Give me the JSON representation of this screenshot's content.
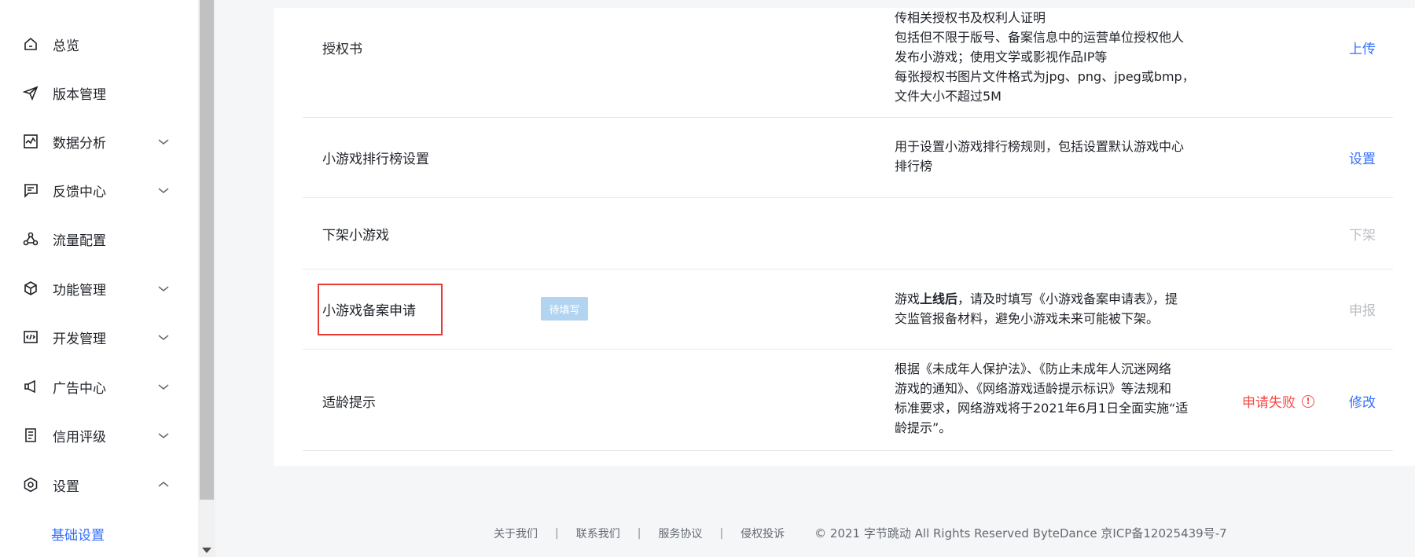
{
  "sidebar": {
    "items": [
      {
        "label": "总览"
      },
      {
        "label": "版本管理"
      },
      {
        "label": "数据分析"
      },
      {
        "label": "反馈中心"
      },
      {
        "label": "流量配置"
      },
      {
        "label": "功能管理"
      },
      {
        "label": "开发管理"
      },
      {
        "label": "广告中心"
      },
      {
        "label": "信用评级"
      },
      {
        "label": "设置"
      }
    ],
    "sub_item": "基础设置"
  },
  "rows": [
    {
      "title": "授权书",
      "desc_lines": [
        "传相关授权书及权利人证明",
        "包括但不限于版号、备案信息中的运营单位授权他人",
        "发布小游戏；使用文学或影视作品IP等",
        "每张授权书图片文件格式为jpg、png、jpeg或bmp，",
        "文件大小不超过5M"
      ],
      "action": "上传"
    },
    {
      "title": "小游戏排行榜设置",
      "desc_lines": [
        "用于设置小游戏排行榜规则，包括设置默认游戏中心",
        "排行榜"
      ],
      "action": "设置"
    },
    {
      "title": "下架小游戏",
      "action": "下架"
    },
    {
      "title": "小游戏备案申请",
      "badge": "待填写",
      "desc_pre": "游戏",
      "desc_bold": "上线后",
      "desc_post": "，请及时填写《小游戏备案申请表》，提",
      "desc_line2": "交监管报备材料，避免小游戏未来可能被下架。",
      "action": "申报"
    },
    {
      "title": "适龄提示",
      "desc_lines": [
        "根据《未成年人保护法》、《防止未成年人沉迷网络",
        "游戏的通知》、《网络游戏适龄提示标识》等法规和",
        "标准要求，网络游戏将于2021年6月1日全面实施“适",
        "龄提示”。"
      ],
      "status": "申请失败",
      "action": "修改"
    }
  ],
  "footer": {
    "links": [
      "关于我们",
      "联系我们",
      "服务协议",
      "侵权投诉"
    ],
    "separator": "|",
    "copyright": "© 2021 字节跳动 All Rights Reserved ByteDance 京ICP备12025439号-7"
  },
  "colors": {
    "accent": "#3370ff",
    "danger": "#f54a45",
    "highlight_border": "#e53935",
    "badge_bg": "#b3d4f0"
  },
  "icons": [
    "home-icon",
    "send-icon",
    "chart-icon",
    "message-icon",
    "flow-icon",
    "cube-icon",
    "code-icon",
    "megaphone-icon",
    "document-icon",
    "settings-icon",
    "chevron-down-icon",
    "chevron-up-icon",
    "info-icon"
  ]
}
